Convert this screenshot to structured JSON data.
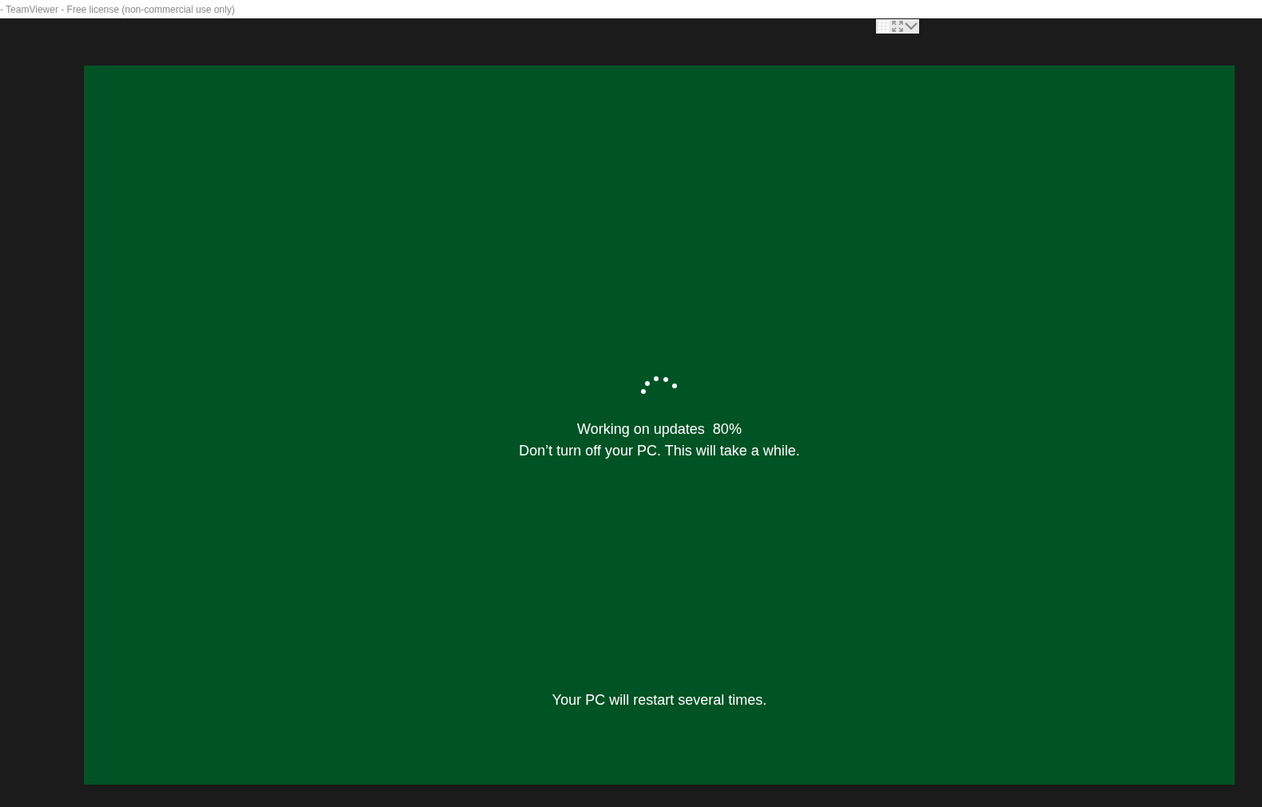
{
  "window": {
    "title": "- TeamViewer - Free license (non-commercial use only)"
  },
  "remote_screen": {
    "status": "Working on updates  80%",
    "warning": "Don’t turn off your PC. This will take a while.",
    "footer": "Your PC will restart several times."
  }
}
